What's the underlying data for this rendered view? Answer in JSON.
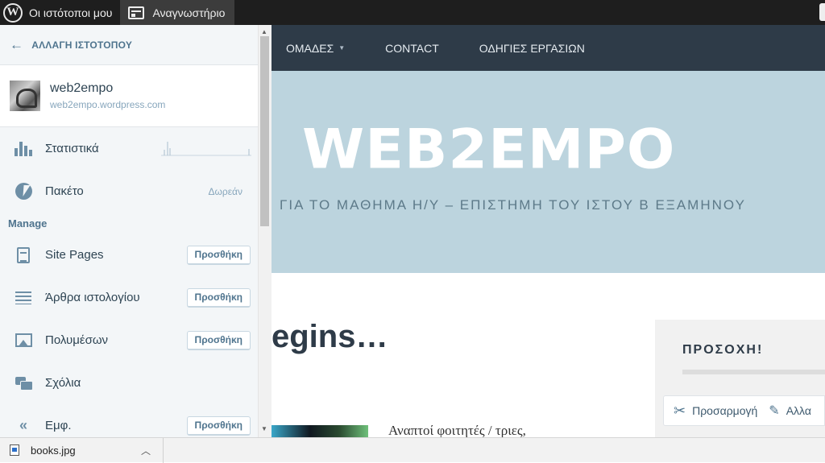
{
  "adminbar": {
    "my_sites": "Οι ιστότοποι μου",
    "reader": "Αναγνωστήριο"
  },
  "sidebar": {
    "switch_site": "ΑΛΛΑΓΗ ΙΣΤΟΤΟΠΟΥ",
    "site_name": "web2empo",
    "site_url": "web2empo.wordpress.com",
    "stats_label": "Στατιστικά",
    "plan_label": "Πακέτο",
    "plan_value": "Δωρεάν",
    "manage_heading": "Manage",
    "items": [
      {
        "label": "Site Pages",
        "button": "Προσθήκη"
      },
      {
        "label": "Άρθρα ιστολογίου",
        "button": "Προσθήκη"
      },
      {
        "label": "Πολυμέσων",
        "button": "Προσθήκη"
      },
      {
        "label": "Σχόλια"
      },
      {
        "label": "Εμφ.",
        "button": "Προσθήκη"
      }
    ]
  },
  "site": {
    "nav": [
      "ΟΜΑΔΕΣ",
      "CONTACT",
      "ΟΔΗΓΙΕΣ ΕΡΓΑΣΙΩΝ"
    ],
    "hero_title": "WEB2EMPO",
    "hero_subtitle": "ΓΙΑ ΤΟ ΜΑΘΗΜΑ Η/Υ – ΕΠΙΣΤΗΜΗ ΤΟΥ ΙΣΤΟΥ Β ΕΞΑΜΗΝΟΥ",
    "post_title": "egins…",
    "post_text": "Αναπτοί φοιτητές / τριες,",
    "widget_title": "ΠΡΟΣΟΧΗ!",
    "customize_label": "Προσαρμογή",
    "edit_label": "Αλλα"
  },
  "downloads": {
    "file_name": "books.jpg"
  },
  "colors": {
    "adminbar_bg": "#1e1e1e",
    "sidebar_bg": "#f3f6f8",
    "nav_bg": "#2e3b48",
    "hero_bg": "#bcd4de"
  }
}
